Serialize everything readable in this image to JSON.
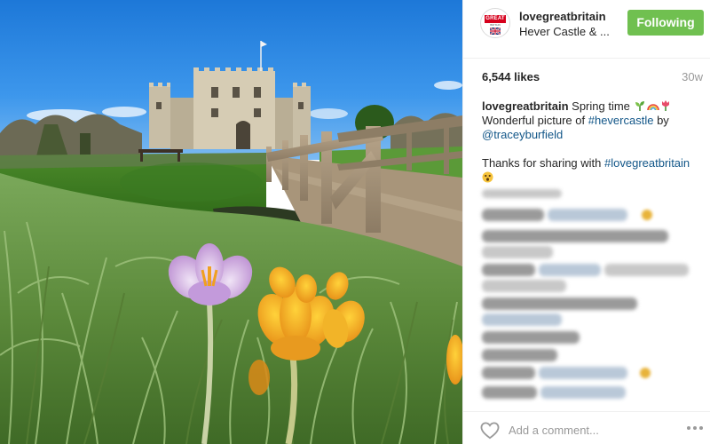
{
  "post": {
    "image_alt": "Crocuses in front of Hever Castle",
    "account": {
      "username": "lovegreatbritain",
      "location": "Hever Castle & ...",
      "avatar_text_top": "GREAT",
      "avatar_text_bottom": "BRITAIN"
    },
    "follow_label": "Following",
    "likes": "6,544 likes",
    "age": "30w",
    "caption": {
      "username": "lovegreatbritain",
      "line1_text": "Spring time",
      "line1_emoji": [
        "seedling-emoji",
        "rainbow-emoji",
        "tulip-emoji"
      ],
      "line2_text": "Wonderful picture of",
      "hashtag1": "#hevercastle",
      "line2_by": "by",
      "mention": "@traceyburfield",
      "thanks_text": "Thanks for sharing with",
      "hashtag2": "#lovegreatbritain",
      "thanks_emoji": "astonished-face-emoji"
    },
    "comment_placeholder": "Add a comment...",
    "icons": {
      "like": "heart-outline-icon",
      "more": "more-options-icon"
    },
    "colors": {
      "follow_green": "#70c050",
      "link_blue": "#125688",
      "muted": "#999999"
    }
  }
}
